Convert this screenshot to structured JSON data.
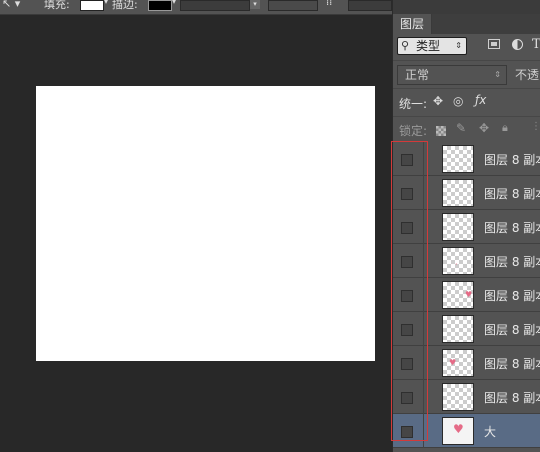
{
  "options_bar": {
    "fill_label": "填充:",
    "stroke_label": "描边:"
  },
  "layers_panel": {
    "tab_label": "图层",
    "filter": {
      "kind_label": "类型"
    },
    "blend": {
      "mode_label": "正常",
      "opacity_label": "不透"
    },
    "unify_label": "统一:",
    "lock_label": "锁定:",
    "layers": [
      {
        "name": "图层 8 副本"
      },
      {
        "name": "图层 8 副本"
      },
      {
        "name": "图层 8 副本"
      },
      {
        "name": "图层 8 副本"
      },
      {
        "name": "图层 8 副本"
      },
      {
        "name": "图层 8 副本"
      },
      {
        "name": "图层 8 副本"
      },
      {
        "name": "图层 8 副本"
      },
      {
        "name": "大"
      }
    ]
  },
  "colors": {
    "workspace": "#282828",
    "panel": "#535353",
    "selected_layer": "#596b85",
    "highlight_box": "#d33a3a",
    "canvas": "#ffffff"
  }
}
